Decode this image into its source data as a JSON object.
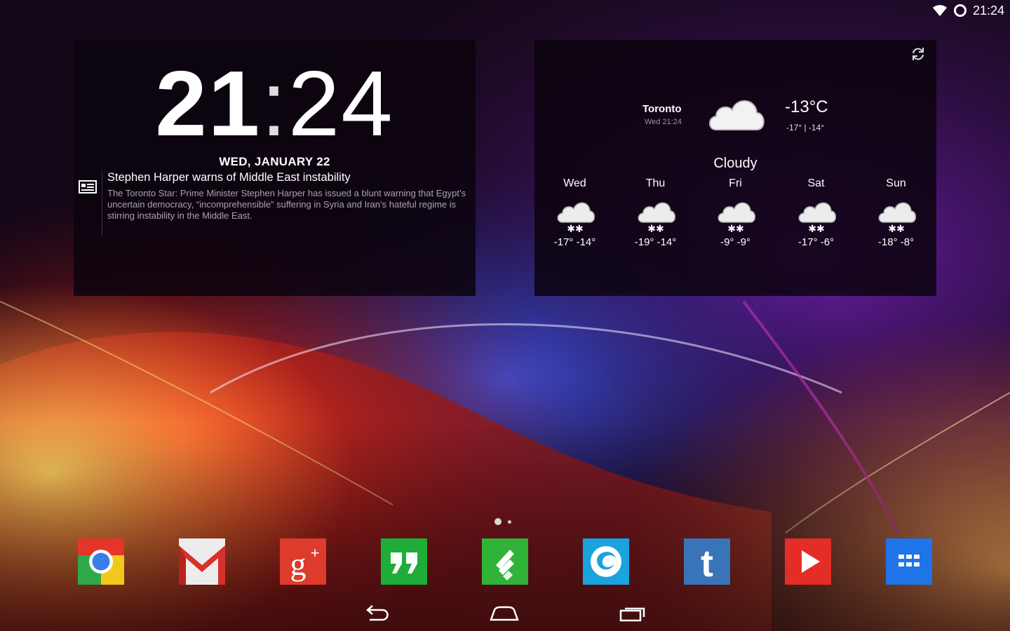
{
  "status_bar": {
    "time": "21:24",
    "icons": [
      "wifi-icon",
      "sync-ring-icon"
    ]
  },
  "clock_widget": {
    "hours": "21",
    "separator": ":",
    "minutes": "24",
    "date": "WED, JANUARY 22",
    "news": {
      "icon": "news-icon",
      "headline": "Stephen Harper warns of Middle East instability",
      "summary": "The Toronto Star: Prime Minister Stephen Harper has issued a blunt warning that Egypt’s uncertain democracy, “incomprehensible” suffering in Syria and Iran’s hateful regime is stirring instability in the Middle East."
    }
  },
  "weather_widget": {
    "refresh_icon": "refresh-icon",
    "city": "Toronto",
    "updated": "Wed 21:24",
    "current_temp": "-13°C",
    "current_range": "-17° | -14°",
    "condition": "Cloudy",
    "forecast": [
      {
        "day": "Wed",
        "range": "-17° -14°",
        "icon": "snow-cloud-icon"
      },
      {
        "day": "Thu",
        "range": "-19° -14°",
        "icon": "snow-cloud-icon"
      },
      {
        "day": "Fri",
        "range": "-9° -9°",
        "icon": "snow-cloud-icon"
      },
      {
        "day": "Sat",
        "range": "-17° -6°",
        "icon": "snow-cloud-icon"
      },
      {
        "day": "Sun",
        "range": "-18° -8°",
        "icon": "snow-cloud-icon"
      }
    ]
  },
  "page_indicator": {
    "pages": 2,
    "current": 1
  },
  "dock": {
    "apps": [
      {
        "name": "Chrome",
        "color": "#3b7de8"
      },
      {
        "name": "Gmail",
        "color": "#e8e8e8"
      },
      {
        "name": "Google+",
        "color": "#dd3b2c"
      },
      {
        "name": "Hangouts",
        "color": "#1fad3a"
      },
      {
        "name": "Feedly",
        "color": "#31b33a"
      },
      {
        "name": "Browser",
        "color": "#1aa3dd"
      },
      {
        "name": "Tumblr",
        "color": "#3a74b8"
      },
      {
        "name": "YouTube",
        "color": "#e52d27"
      },
      {
        "name": "App drawer",
        "color": "#1f74e8"
      }
    ]
  },
  "nav_bar": {
    "buttons": [
      "back-icon",
      "home-icon",
      "recents-icon"
    ]
  }
}
